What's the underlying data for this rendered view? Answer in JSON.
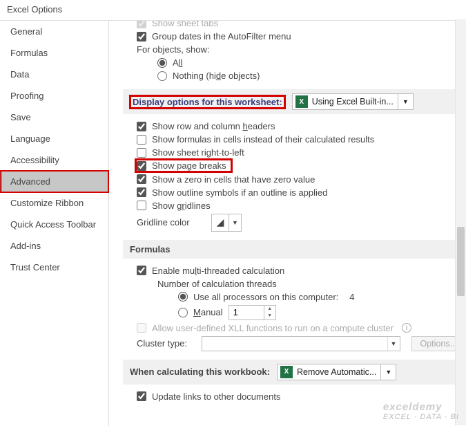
{
  "title": "Excel Options",
  "sidebar": {
    "items": [
      {
        "label": "General"
      },
      {
        "label": "Formulas"
      },
      {
        "label": "Data"
      },
      {
        "label": "Proofing"
      },
      {
        "label": "Save"
      },
      {
        "label": "Language"
      },
      {
        "label": "Accessibility"
      },
      {
        "label": "Advanced"
      },
      {
        "label": "Customize Ribbon"
      },
      {
        "label": "Quick Access Toolbar"
      },
      {
        "label": "Add-ins"
      },
      {
        "label": "Trust Center"
      }
    ]
  },
  "top": {
    "show_sheet_tabs": "Show sheet tabs",
    "group_dates": "Group dates in the AutoFilter menu",
    "for_objects": "For objects, show:",
    "all_pre": "A",
    "all_ul": "ll",
    "nothing_pre": "Nothing (hi",
    "nothing_ul": "d",
    "nothing_post": "e objects)"
  },
  "ws_section": {
    "header": "Display options for this worksheet:",
    "workbook": "Using Excel Built-in...",
    "row_col_pre": "Show row and column ",
    "row_col_ul": "h",
    "row_col_post": "eaders",
    "show_formulas": "Show formulas in cells instead of their calculated results",
    "right_to_left": "Show sheet right-to-left",
    "page_breaks": "Show page breaks",
    "zero": "Show a zero in cells that have zero value",
    "outline": "Show outline symbols if an outline is applied",
    "gridlines_pre": "Show g",
    "gridlines_ul": "r",
    "gridlines_post": "idlines",
    "gridline_color": "Gridline color"
  },
  "formulas_section": {
    "header": "Formulas",
    "multi_pre": "Enable mu",
    "multi_ul": "l",
    "multi_post": "ti-threaded calculation",
    "num_threads": "Number of calculation threads",
    "all_proc": "Use all processors on this computer:",
    "proc_count": "4",
    "manual_ul": "M",
    "manual_post": "anual",
    "manual_val": "1",
    "xll": "Allow user-defined XLL functions to run on a compute cluster",
    "cluster_type": "Cluster type:",
    "options_btn": "Options..."
  },
  "calc_section": {
    "header": "When calculating this workbook:",
    "workbook": "Remove Automatic...",
    "update_links": "Update links to other documents"
  },
  "watermark": {
    "brand": "exceldemy",
    "sub": "EXCEL · DATA · BI"
  }
}
